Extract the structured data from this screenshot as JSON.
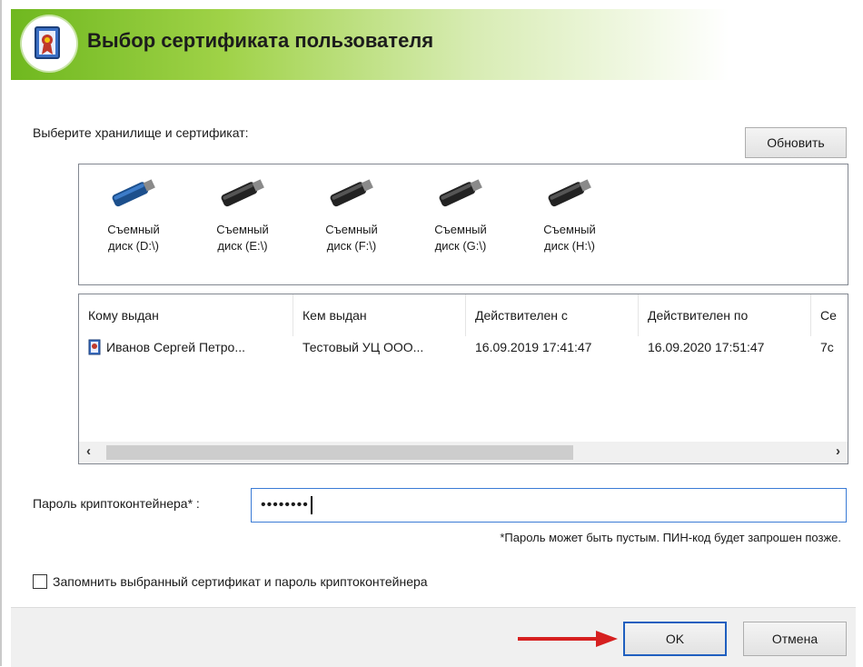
{
  "title": "Выбор сертификата пользователя",
  "store_label": "Выберите хранилище и сертификат:",
  "refresh_button": "Обновить",
  "drives": [
    {
      "line1": "Съемный",
      "line2": "диск (D:\\)",
      "color": "#1c4f8c",
      "icon": "usb-drive-icon"
    },
    {
      "line1": "Съемный",
      "line2": "диск (E:\\)",
      "color": "#222222",
      "icon": "usb-drive-icon"
    },
    {
      "line1": "Съемный",
      "line2": "диск (F:\\)",
      "color": "#222222",
      "icon": "usb-drive-icon"
    },
    {
      "line1": "Съемный",
      "line2": "диск (G:\\)",
      "color": "#222222",
      "icon": "usb-drive-icon"
    },
    {
      "line1": "Съемный",
      "line2": "диск (H:\\)",
      "color": "#222222",
      "icon": "usb-drive-icon"
    }
  ],
  "columns": [
    "Кому выдан",
    "Кем выдан",
    "Действителен с",
    "Действителен по",
    "Се"
  ],
  "rows": [
    {
      "issued_to": "Иванов Сергей Петро...",
      "issued_by": "Тестовый УЦ ООО...",
      "valid_from": "16.09.2019 17:41:47",
      "valid_to": "16.09.2020 17:51:47",
      "extra": "7c"
    }
  ],
  "password_label": "Пароль криптоконтейнера* :",
  "password_value": "••••••••",
  "hint": "*Пароль может быть пустым. ПИН-код будет запрошен позже.",
  "remember_label": "Запомнить выбранный сертификат и пароль криптоконтейнера",
  "remember_checked": false,
  "ok_button": "OK",
  "cancel_button": "Отмена",
  "accent_color": "#6fb81f",
  "arrow_color": "#d62020"
}
